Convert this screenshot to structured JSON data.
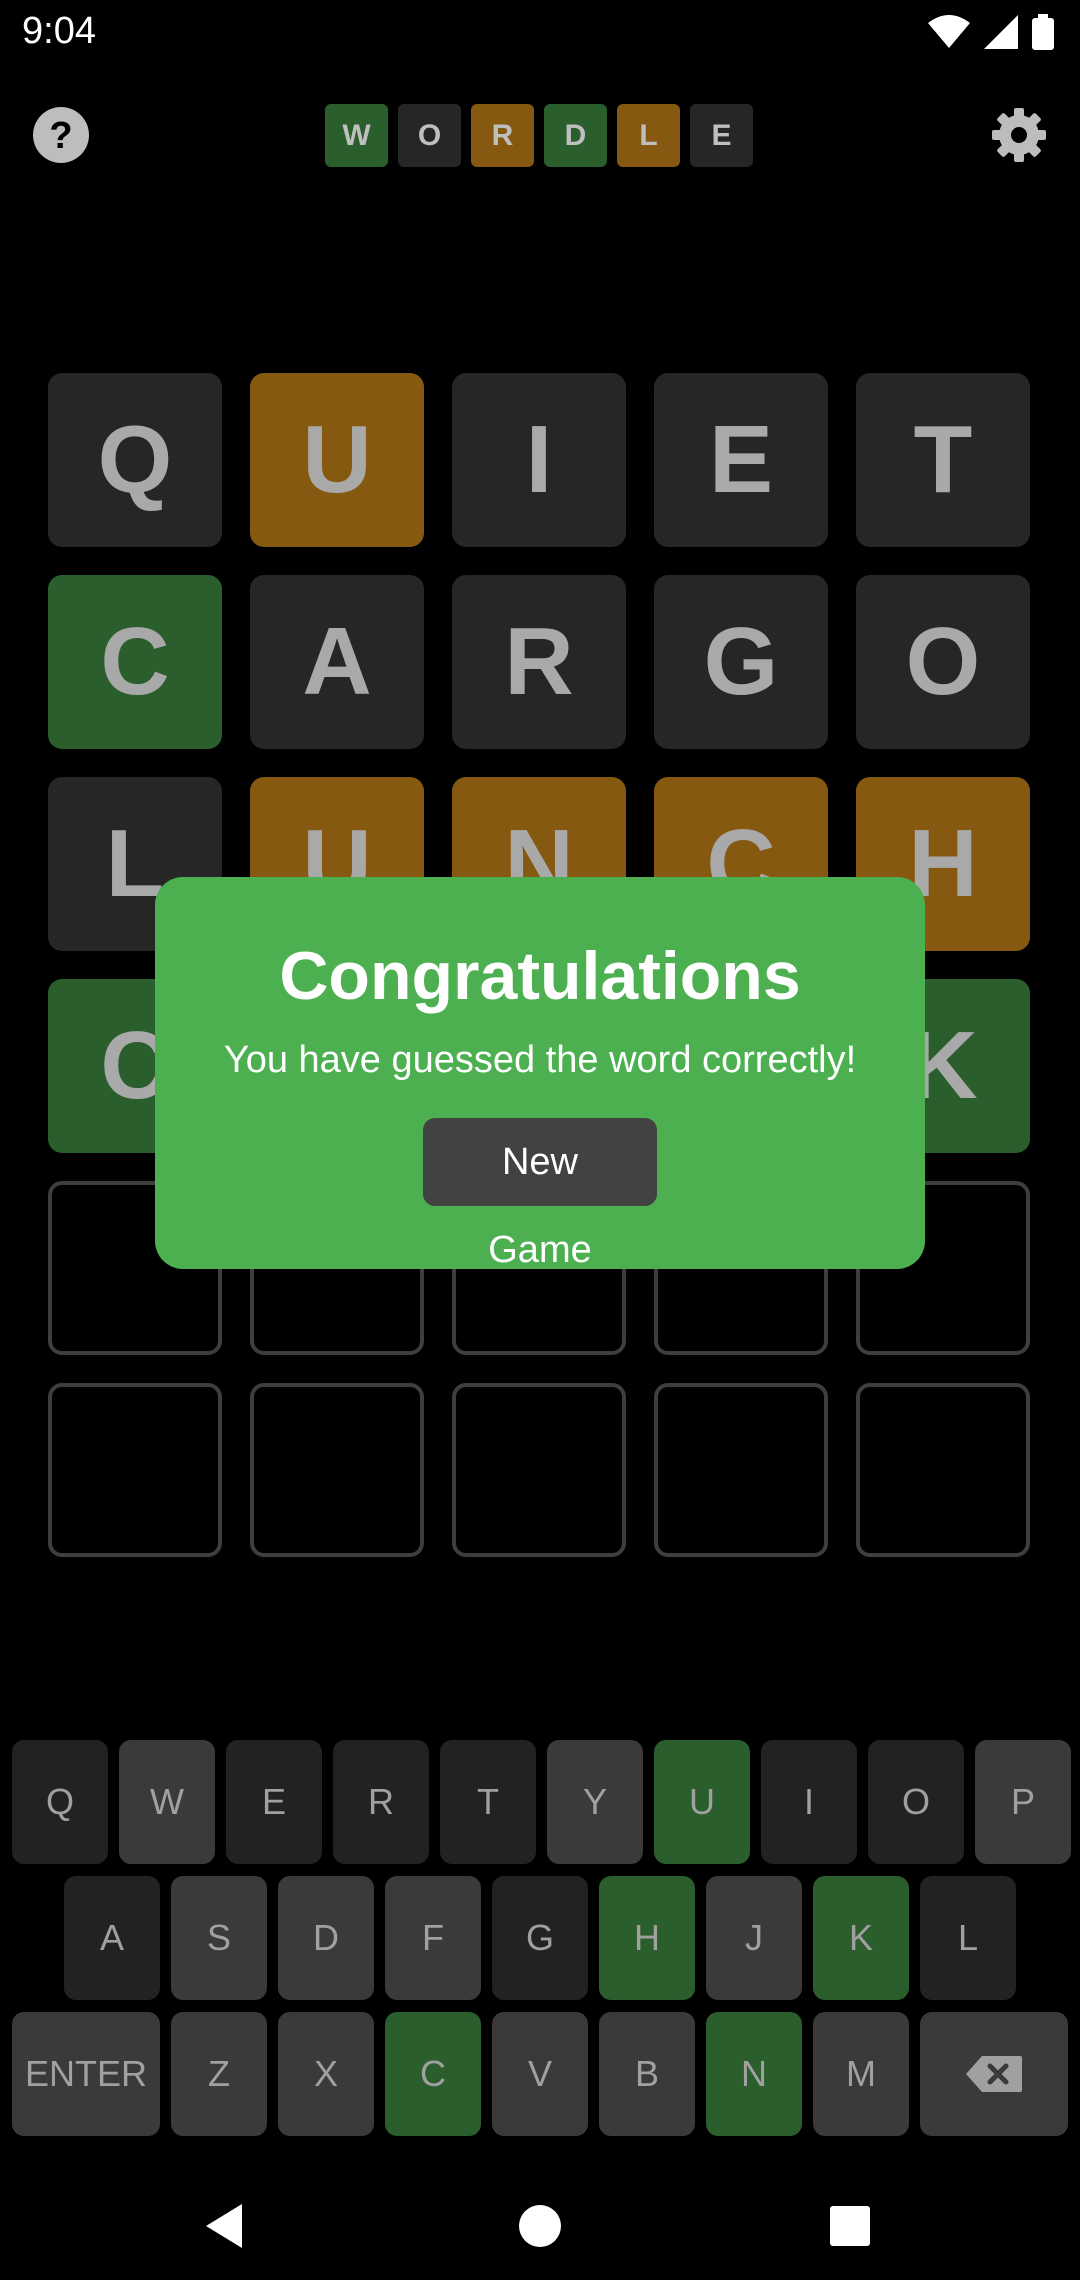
{
  "status_bar": {
    "time": "9:04"
  },
  "header": {
    "help_icon": "question-circle-icon",
    "settings_icon": "gear-icon",
    "logo": [
      {
        "letter": "W",
        "color": "#2a5e2c"
      },
      {
        "letter": "O",
        "color": "#262626"
      },
      {
        "letter": "R",
        "color": "#85590f"
      },
      {
        "letter": "D",
        "color": "#2a5e2c"
      },
      {
        "letter": "L",
        "color": "#85590f"
      },
      {
        "letter": "E",
        "color": "#262626"
      }
    ]
  },
  "board": {
    "rows": [
      [
        {
          "letter": "Q",
          "state": "gray"
        },
        {
          "letter": "U",
          "state": "yellow"
        },
        {
          "letter": "I",
          "state": "gray"
        },
        {
          "letter": "E",
          "state": "gray"
        },
        {
          "letter": "T",
          "state": "gray"
        }
      ],
      [
        {
          "letter": "C",
          "state": "green"
        },
        {
          "letter": "A",
          "state": "gray"
        },
        {
          "letter": "R",
          "state": "gray"
        },
        {
          "letter": "G",
          "state": "gray"
        },
        {
          "letter": "O",
          "state": "gray"
        }
      ],
      [
        {
          "letter": "L",
          "state": "gray"
        },
        {
          "letter": "U",
          "state": "yellow"
        },
        {
          "letter": "N",
          "state": "yellow"
        },
        {
          "letter": "C",
          "state": "yellow"
        },
        {
          "letter": "H",
          "state": "yellow"
        }
      ],
      [
        {
          "letter": "C",
          "state": "green"
        },
        {
          "letter": "",
          "state": "green"
        },
        {
          "letter": "",
          "state": "green"
        },
        {
          "letter": "",
          "state": "green"
        },
        {
          "letter": "K",
          "state": "green"
        }
      ],
      [
        {
          "letter": "",
          "state": "empty"
        },
        {
          "letter": "",
          "state": "empty"
        },
        {
          "letter": "",
          "state": "empty"
        },
        {
          "letter": "",
          "state": "empty"
        },
        {
          "letter": "",
          "state": "empty"
        }
      ],
      [
        {
          "letter": "",
          "state": "empty"
        },
        {
          "letter": "",
          "state": "empty"
        },
        {
          "letter": "",
          "state": "empty"
        },
        {
          "letter": "",
          "state": "empty"
        },
        {
          "letter": "",
          "state": "empty"
        }
      ]
    ]
  },
  "popup": {
    "title": "Congratulations",
    "message": "You have guessed the word correctly!",
    "button": "New Game"
  },
  "keyboard": {
    "rows": [
      [
        {
          "k": "Q",
          "s": "dark"
        },
        {
          "k": "W",
          "s": "mid"
        },
        {
          "k": "E",
          "s": "dark"
        },
        {
          "k": "R",
          "s": "dark"
        },
        {
          "k": "T",
          "s": "dark"
        },
        {
          "k": "Y",
          "s": "mid"
        },
        {
          "k": "U",
          "s": "green"
        },
        {
          "k": "I",
          "s": "dark"
        },
        {
          "k": "O",
          "s": "dark"
        },
        {
          "k": "P",
          "s": "mid"
        }
      ],
      [
        {
          "k": "A",
          "s": "dark"
        },
        {
          "k": "S",
          "s": "mid"
        },
        {
          "k": "D",
          "s": "mid"
        },
        {
          "k": "F",
          "s": "mid"
        },
        {
          "k": "G",
          "s": "dark"
        },
        {
          "k": "H",
          "s": "green"
        },
        {
          "k": "J",
          "s": "mid"
        },
        {
          "k": "K",
          "s": "green"
        },
        {
          "k": "L",
          "s": "dark"
        }
      ],
      [
        {
          "k": "ENTER",
          "s": "mid",
          "wide": true
        },
        {
          "k": "Z",
          "s": "mid"
        },
        {
          "k": "X",
          "s": "mid"
        },
        {
          "k": "C",
          "s": "green"
        },
        {
          "k": "V",
          "s": "mid"
        },
        {
          "k": "B",
          "s": "mid"
        },
        {
          "k": "N",
          "s": "green"
        },
        {
          "k": "M",
          "s": "mid"
        },
        {
          "k": "",
          "s": "mid",
          "wide": true,
          "icon": "backspace-icon"
        }
      ]
    ]
  },
  "nav": {
    "back_icon": "back-triangle-icon",
    "home_icon": "home-circle-icon",
    "recents_icon": "recents-square-icon"
  }
}
